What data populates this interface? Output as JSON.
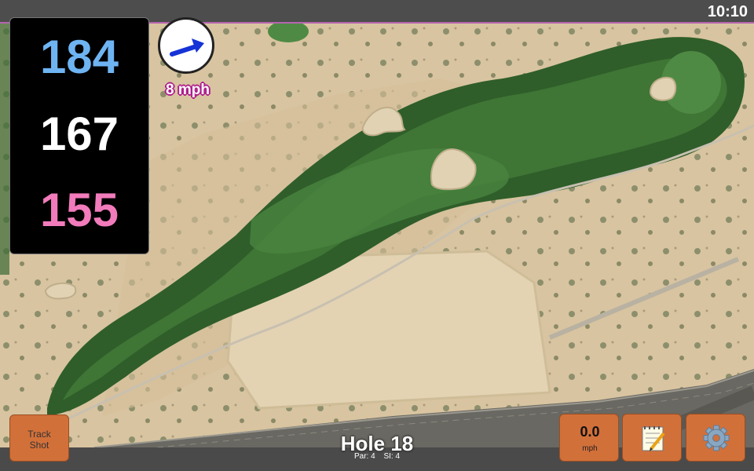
{
  "status_bar": {
    "time": "10:10"
  },
  "distances": {
    "back": "184",
    "middle": "167",
    "front": "155"
  },
  "wind": {
    "speed_label": "8 mph",
    "direction_icon": "wind-arrow-icon"
  },
  "hole": {
    "title": "Hole 18",
    "par_label": "Par: 4",
    "si_label": "SI: 4"
  },
  "buttons": {
    "track_shot_line1": "Track",
    "track_shot_line2": "Shot",
    "wind_value": "0.0",
    "wind_unit": "mph",
    "notes_icon": "notepad-icon",
    "settings_icon": "gear-icon"
  },
  "colors": {
    "back_distance": "#6fb4f2",
    "middle_distance": "#ffffff",
    "front_distance": "#f27bbb",
    "button": "#d2703a",
    "accent": "#b565b0"
  }
}
